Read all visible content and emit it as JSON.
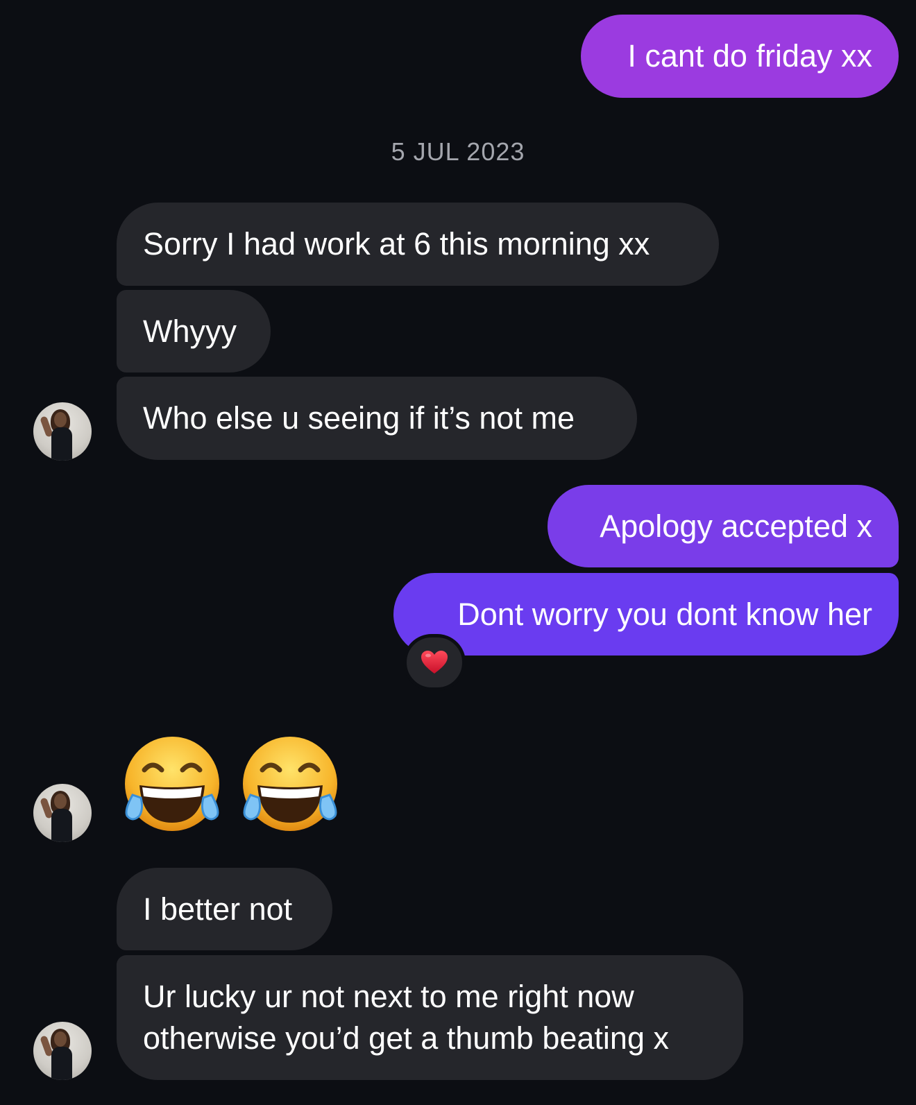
{
  "messages": {
    "m1": "I cant do friday xx",
    "date": "5 JUL 2023",
    "m2": "Sorry I had work at 6 this morning xx",
    "m3": "Whyyy",
    "m4": "Who else u seeing if it’s not me",
    "m5": "Apology accepted x",
    "m6": "Dont worry you dont know her",
    "m7": "I better not",
    "m8": "Ur lucky ur not next to me right now otherwise you’d get a thumb beating x"
  },
  "reaction": {
    "icon": "red-heart-icon",
    "glyph": "❤️"
  },
  "emoji_message": [
    "face-with-tears-of-joy-icon",
    "face-with-tears-of-joy-icon"
  ],
  "colors": {
    "background": "#0c0e13",
    "incoming_bubble": "#25262b",
    "outgoing_purple_1": "#9b3be0",
    "outgoing_purple_2": "#7a3de9",
    "outgoing_purple_3": "#6a3cf0",
    "date_text": "#a4a6ad"
  }
}
